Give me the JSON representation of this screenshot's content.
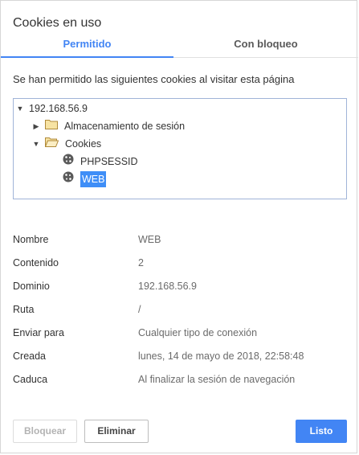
{
  "dialog": {
    "title": "Cookies en uso",
    "tabs": {
      "allowed": "Permitido",
      "blocked": "Con bloqueo"
    },
    "description": "Se han permitido las siguientes cookies al visitar esta página"
  },
  "tree": {
    "root": "192.168.56.9",
    "session_storage": "Almacenamiento de sesión",
    "cookies_folder": "Cookies",
    "cookie_1": "PHPSESSID",
    "cookie_2": "WEB"
  },
  "details": {
    "name_label": "Nombre",
    "name_value": "WEB",
    "content_label": "Contenido",
    "content_value": "2",
    "domain_label": "Dominio",
    "domain_value": "192.168.56.9",
    "path_label": "Ruta",
    "path_value": "/",
    "send_label": "Enviar para",
    "send_value": "Cualquier tipo de conexión",
    "created_label": "Creada",
    "created_value": "lunes, 14 de mayo de 2018, 22:58:48",
    "expires_label": "Caduca",
    "expires_value": "Al finalizar la sesión de navegación"
  },
  "buttons": {
    "block": "Bloquear",
    "delete": "Eliminar",
    "done": "Listo"
  },
  "colors": {
    "accent": "#4285f4",
    "selection": "#3f8ef7"
  }
}
